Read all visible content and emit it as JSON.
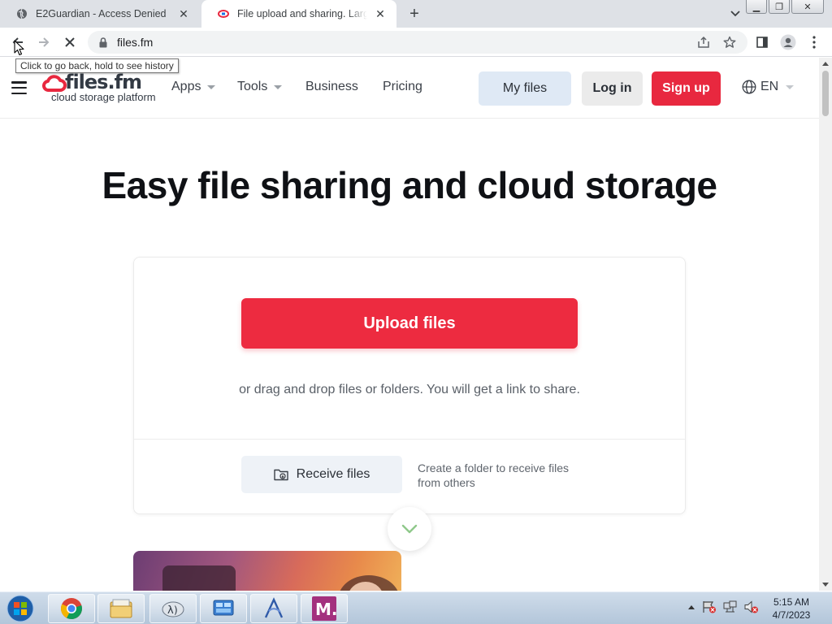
{
  "browser": {
    "tabs": [
      {
        "title": "E2Guardian - Access Denied",
        "active": false
      },
      {
        "title": "File upload and sharing. Large files",
        "active": true
      }
    ],
    "url": "files.fm",
    "tooltip": "Click to go back, hold to see history"
  },
  "site": {
    "logo_text": "files.fm",
    "logo_subtitle": "cloud storage platform",
    "nav": [
      {
        "label": "Apps",
        "has_dropdown": true
      },
      {
        "label": "Tools",
        "has_dropdown": true
      },
      {
        "label": "Business",
        "has_dropdown": false
      },
      {
        "label": "Pricing",
        "has_dropdown": false
      }
    ],
    "my_files_label": "My files",
    "login_label": "Log in",
    "signup_label": "Sign up",
    "language": "EN",
    "brand_color": "#ed2b40"
  },
  "hero": {
    "title": "Easy file sharing and cloud storage",
    "upload_label": "Upload files",
    "drag_text": "or drag and drop files or folders. You will get a link to share.",
    "receive_label": "Receive files",
    "receive_desc": "Create a folder to receive files from others"
  },
  "taskbar": {
    "items": [
      "chrome-icon",
      "file-explorer-icon",
      "terminal-icon",
      "control-panel-icon",
      "app-icon",
      "m-app-icon"
    ],
    "time": "5:15 AM",
    "date": "4/7/2023"
  }
}
